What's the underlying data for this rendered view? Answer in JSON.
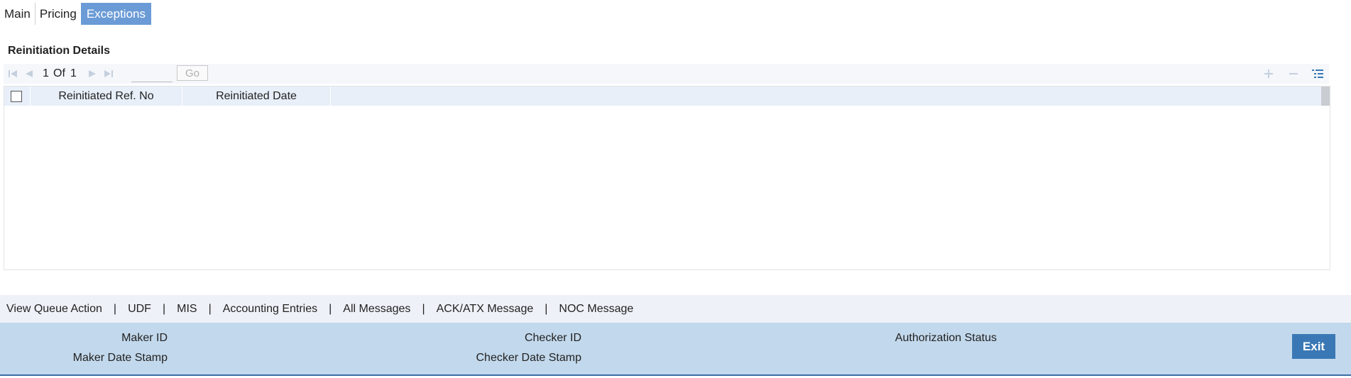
{
  "tabs": [
    {
      "label": "Main"
    },
    {
      "label": "Pricing"
    },
    {
      "label": "Exceptions"
    }
  ],
  "section": {
    "title": "Reinitiation Details"
  },
  "pagination": {
    "current": "1",
    "of_label": "Of",
    "total": "1",
    "go_label": "Go"
  },
  "grid": {
    "columns": [
      "Reinitiated Ref. No",
      "Reinitiated Date"
    ],
    "rows": []
  },
  "footer_links": [
    "View Queue Action",
    "UDF",
    "MIS",
    "Accounting Entries",
    "All Messages",
    "ACK/ATX Message",
    "NOC Message"
  ],
  "footer_separator": "|",
  "status": {
    "maker_id": "Maker ID",
    "maker_date_stamp": "Maker Date Stamp",
    "checker_id": "Checker ID",
    "checker_date_stamp": "Checker Date Stamp",
    "authorization_status": "Authorization Status"
  },
  "exit_label": "Exit",
  "colors": {
    "active_tab": "#6b9bd6",
    "grid_header": "#e8eff9",
    "status_bar": "#c2d8ec",
    "exit_button": "#3a78b5"
  }
}
